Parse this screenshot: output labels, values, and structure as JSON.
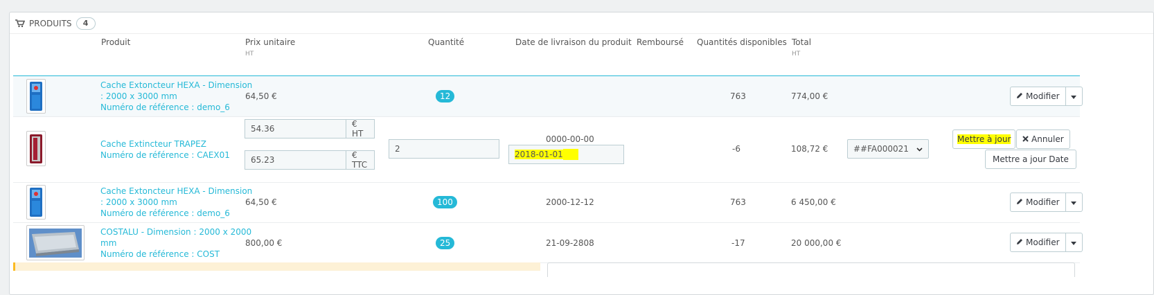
{
  "panel": {
    "title": "PRODUITS",
    "count": "4"
  },
  "columns": {
    "produit": "Produit",
    "prix": "Prix unitaire",
    "prix_sub": "HT",
    "quantite": "Quantité",
    "date": "Date de livraison du produit",
    "rembourse": "Remboursé",
    "disponibles": "Quantités disponibles",
    "total": "Total",
    "total_sub": "HT"
  },
  "rows": [
    {
      "thumb": "blue-cabinet",
      "name_lines": [
        "Cache Extoncteur HEXA - Dimension",
        ": 2000 x 3000 mm",
        "Numéro de référence : demo_6"
      ],
      "price": "64,50 €",
      "qty": "12",
      "date": "",
      "available": "763",
      "total": "774,00 €",
      "action": "Modifier"
    },
    {
      "thumb": "red-cabinet",
      "name_lines": [
        "Cache Extincteur TRAPEZ",
        "Numéro de référence : CAEX01"
      ],
      "price_ht": "54.36",
      "price_ht_unit": "€ HT",
      "price_ttc": "65.23",
      "price_ttc_unit": "€ TTC",
      "qty_input": "2",
      "date_current": "0000-00-00",
      "date_input": "2018-01-01",
      "available": "-6",
      "total": "108,72 €",
      "invoice_select": "##FA000021",
      "update_button": "Mettre à jour",
      "cancel_button": "Annuler",
      "update_date_button": "Mettre a jour Date"
    },
    {
      "thumb": "blue-cabinet",
      "name_lines": [
        "Cache Extoncteur HEXA - Dimension",
        ": 2000 x 3000 mm",
        "Numéro de référence : demo_6"
      ],
      "price": "64,50 €",
      "qty": "100",
      "date": "2000-12-12",
      "available": "763",
      "total": "6 450,00 €",
      "action": "Modifier"
    },
    {
      "thumb": "metal-tray",
      "name_lines": [
        "COSTALU - Dimension : 2000 x 2000",
        "mm",
        "Numéro de référence : COST"
      ],
      "price": "800,00 €",
      "qty": "25",
      "date": "21-09-2808",
      "available": "-17",
      "total": "20 000,00 €",
      "action": "Modifier"
    }
  ],
  "icons": {
    "cart": "shopping-cart",
    "pencil": "pencil",
    "caret": "caret-down",
    "cross": "times"
  },
  "colors": {
    "link": "#25b9d7",
    "badge": "#25b9d7",
    "highlight": "#ffff00",
    "warning_bg": "#fdf1d6"
  }
}
